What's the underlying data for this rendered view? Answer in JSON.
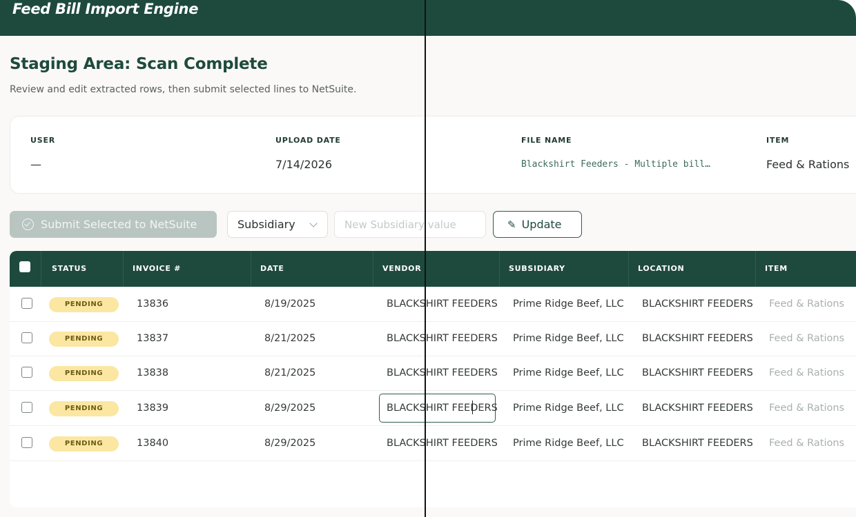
{
  "header": {
    "app_title": "Feed Bill Import Engine"
  },
  "page": {
    "title": "Staging Area: Scan Complete",
    "subtitle": "Review and edit extracted rows, then submit selected lines to NetSuite."
  },
  "info": {
    "user_label": "USER",
    "user_value": "—",
    "upload_date_label": "UPLOAD DATE",
    "upload_date_value": "7/14/2026",
    "file_name_label": "FILE NAME",
    "file_name_value": "Blackshirt Feeders - Multiple bill…",
    "item_label": "ITEM",
    "item_value": "Feed & Rations"
  },
  "toolbar": {
    "submit_label": "Submit Selected to NetSuite",
    "field_select_value": "Subsidiary",
    "value_placeholder": "New Subsidiary value",
    "update_label": "Update"
  },
  "table": {
    "columns": [
      "STATUS",
      "INVOICE #",
      "DATE",
      "VENDOR",
      "SUBSIDIARY",
      "LOCATION",
      "ITEM"
    ],
    "rows": [
      {
        "status": "PENDING",
        "invoice": "13836",
        "date": "8/19/2025",
        "vendor": "BLACKSHIRT FEEDERS",
        "subsidiary": "Prime Ridge Beef, LLC",
        "location": "BLACKSHIRT FEEDERS",
        "item": "Feed & Rations"
      },
      {
        "status": "PENDING",
        "invoice": "13837",
        "date": "8/21/2025",
        "vendor": "BLACKSHIRT FEEDERS",
        "subsidiary": "Prime Ridge Beef, LLC",
        "location": "BLACKSHIRT FEEDERS",
        "item": "Feed & Rations"
      },
      {
        "status": "PENDING",
        "invoice": "13838",
        "date": "8/21/2025",
        "vendor": "BLACKSHIRT FEEDERS",
        "subsidiary": "Prime Ridge Beef, LLC",
        "location": "BLACKSHIRT FEEDERS",
        "item": "Feed & Rations"
      },
      {
        "status": "PENDING",
        "invoice": "13839",
        "date": "8/29/2025",
        "vendor": "BLACKSHIRT FEEDERS",
        "subsidiary": "Prime Ridge Beef, LLC",
        "location": "BLACKSHIRT FEEDERS",
        "item": "Feed & Rations"
      },
      {
        "status": "PENDING",
        "invoice": "13840",
        "date": "8/29/2025",
        "vendor": "BLACKSHIRT FEEDERS",
        "subsidiary": "Prime Ridge Beef, LLC",
        "location": "BLACKSHIRT FEEDERS",
        "item": "Feed & Rations"
      }
    ]
  },
  "colors": {
    "brand": "#1e4a3d",
    "pending_badge": "#fbe7a1"
  },
  "icons": {
    "submit": "check-circle-icon",
    "select": "chevron-down-icon",
    "update": "pencil-icon"
  }
}
